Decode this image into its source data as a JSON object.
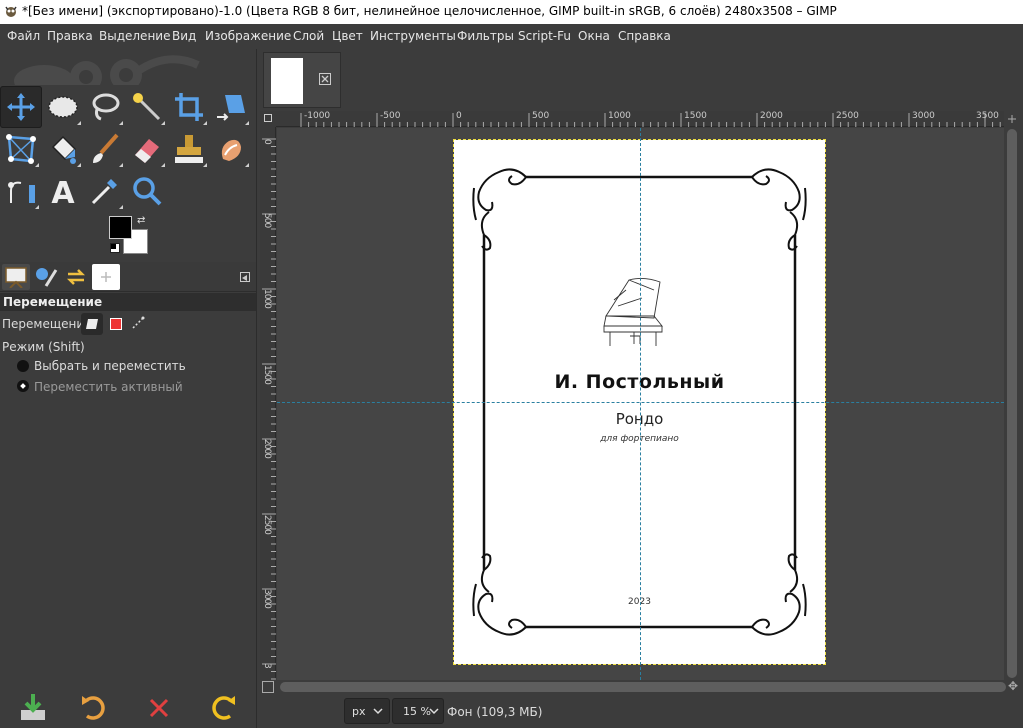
{
  "window": {
    "title": "*[Без имени] (экспортировано)-1.0 (Цвета RGB 8 бит, нелинейное целочисленное, GIMP built-in sRGB, 6 слоёв) 2480x3508 – GIMP"
  },
  "menu": {
    "items": [
      "Файл",
      "Правка",
      "Выделение",
      "Вид",
      "Изображение",
      "Слой",
      "Цвет",
      "Инструменты",
      "Фильтры",
      "Script-Fu",
      "Окна",
      "Справка"
    ]
  },
  "toolbox": {
    "tools": [
      {
        "name": "move-tool-icon",
        "active": true
      },
      {
        "name": "ellipse-select-icon",
        "active": false
      },
      {
        "name": "free-select-icon",
        "active": false
      },
      {
        "name": "fuzzy-select-icon",
        "active": false
      },
      {
        "name": "crop-icon",
        "active": false
      },
      {
        "name": "unified-transform-icon",
        "active": false
      },
      {
        "name": "warp-transform-icon",
        "active": false
      },
      {
        "name": "bucket-fill-icon",
        "active": false
      },
      {
        "name": "paintbrush-icon",
        "active": false
      },
      {
        "name": "eraser-icon",
        "active": false
      },
      {
        "name": "clone-stamp-icon",
        "active": false
      },
      {
        "name": "smudge-icon",
        "active": false
      },
      {
        "name": "paths-icon",
        "active": false
      },
      {
        "name": "text-icon",
        "active": false
      },
      {
        "name": "color-picker-icon",
        "active": false
      },
      {
        "name": "zoom-icon",
        "active": false
      }
    ],
    "fg_color": "#000000",
    "bg_color": "#ffffff",
    "text_tool_glyph": "A"
  },
  "tool_options": {
    "title": "Перемещение",
    "move_label": "Перемещение:",
    "mode_label": "Режим (Shift)",
    "options": [
      {
        "label": "Выбрать и переместить",
        "selected": false
      },
      {
        "label": "Переместить активный",
        "selected": true
      }
    ]
  },
  "bottom_buttons": [
    "save-options-icon",
    "restore-options-icon",
    "delete-options-icon",
    "reset-options-icon"
  ],
  "rulers": {
    "top": [
      "-1000",
      "-500",
      "0",
      "500",
      "1000",
      "1500",
      "2000",
      "2500",
      "3000",
      "3500"
    ],
    "left": [
      "0",
      "500",
      "1000",
      "1500",
      "2000",
      "2500",
      "3000",
      "3"
    ]
  },
  "document": {
    "author": "И. Постольный",
    "title": "Рондо",
    "subtitle": "для фортепиано",
    "year": "2023"
  },
  "status": {
    "unit": "px",
    "zoom": "15 %",
    "layer_info": "Фон (109,3 МБ)"
  },
  "colors": {
    "accent": "#4a8cd6",
    "panel": "#3c3c3c",
    "canvas": "#454545"
  }
}
